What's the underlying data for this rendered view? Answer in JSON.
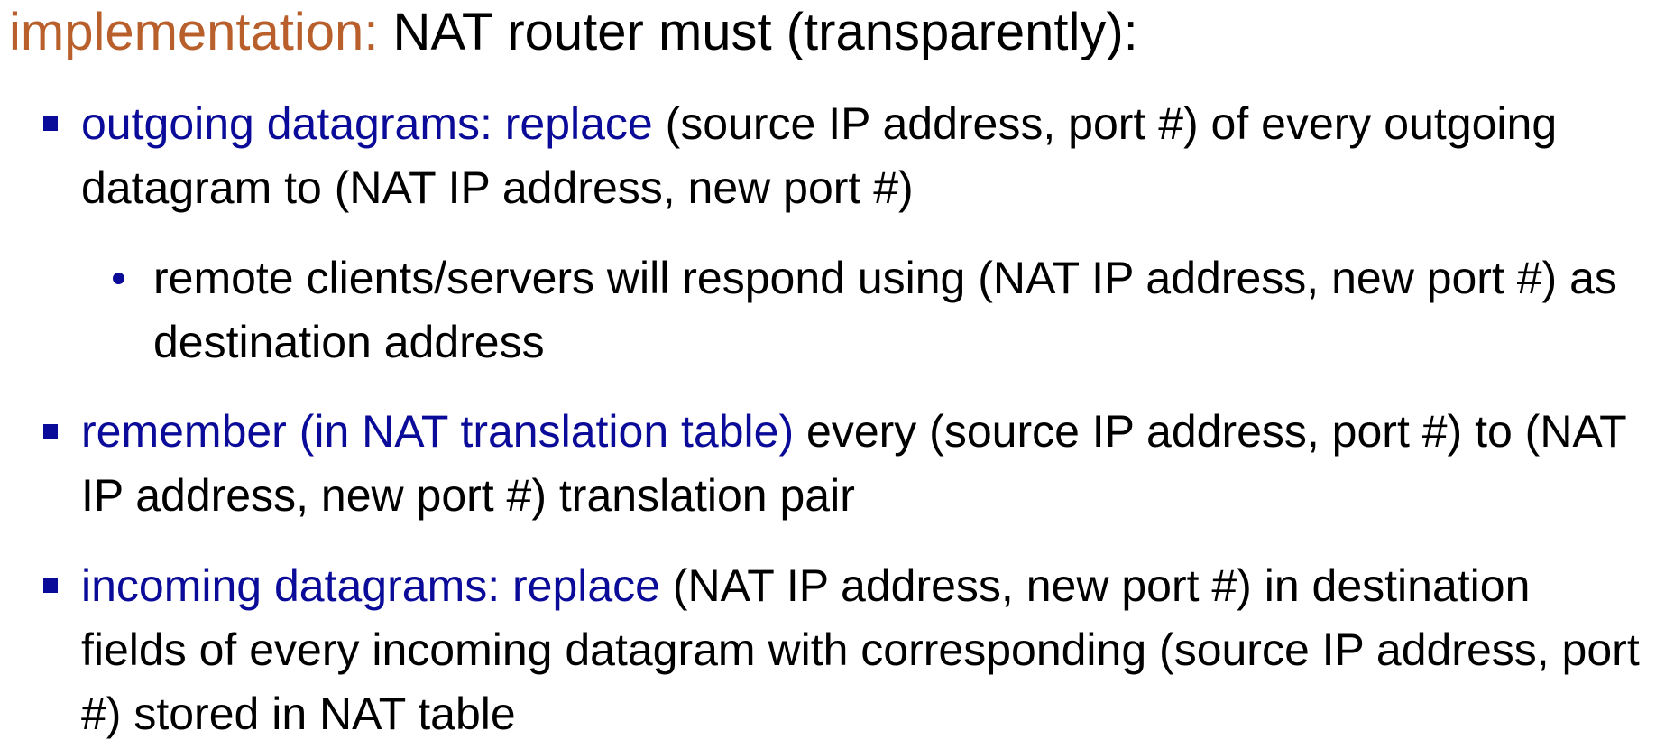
{
  "heading": {
    "accent": "implementation:",
    "rest": " NAT router must (transparently):"
  },
  "colors": {
    "accent": "#b85f2b",
    "highlight": "#0b0b99",
    "text": "#000000"
  },
  "bullets": [
    {
      "highlight": "outgoing datagrams: replace",
      "text": " (source IP address, port #) of every outgoing datagram to (NAT IP address, new port #)",
      "sub": [
        {
          "text": "remote clients/servers will respond using (NAT IP address, new port #) as destination address"
        }
      ]
    },
    {
      "highlight": "remember (in NAT translation table)",
      "text": " every (source IP address, port #) to (NAT IP address, new port #) translation pair"
    },
    {
      "highlight": "incoming datagrams: replace",
      "text": " (NAT IP address, new port #) in destination fields of every incoming datagram with corresponding (source IP address, port #) stored in NAT table"
    }
  ]
}
